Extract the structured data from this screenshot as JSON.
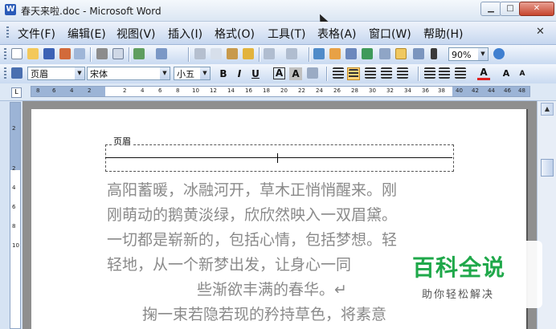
{
  "window": {
    "title": "春天来啦.doc - Microsoft Word",
    "app_icon": "W",
    "controls": {
      "minimize": "▁",
      "maximize": "□",
      "close": "✕"
    }
  },
  "menu": {
    "items": [
      "文件(F)",
      "编辑(E)",
      "视图(V)",
      "插入(I)",
      "格式(O)",
      "工具(T)",
      "表格(A)",
      "窗口(W)",
      "帮助(H)"
    ],
    "close_doc": "✕"
  },
  "standard_toolbar": {
    "zoom": "90%",
    "icons": [
      "new-doc-icon",
      "open-icon",
      "save-icon",
      "permission-icon",
      "email-icon",
      "print-icon",
      "print-preview-icon",
      "spelling-icon",
      "research-icon",
      "cut-icon",
      "copy-icon",
      "paste-icon",
      "format-painter-icon",
      "undo-icon",
      "redo-icon",
      "hyperlink-icon",
      "tables-borders-icon",
      "insert-table-icon",
      "insert-excel-icon",
      "columns-icon",
      "drawing-icon",
      "document-map-icon",
      "show-hide-icon",
      "help-icon"
    ]
  },
  "formatting_toolbar": {
    "style": "页眉",
    "font": "宋体",
    "size": "小五",
    "bold": "B",
    "italic": "I",
    "underline": "U",
    "char_border": "A",
    "char_shading": "A",
    "font_color_letter": "A",
    "grow_font": "A",
    "shrink_font": "A"
  },
  "ruler": {
    "h_ticks": [
      "8",
      "6",
      "4",
      "2",
      "2",
      "4",
      "6",
      "8",
      "10",
      "12",
      "14",
      "16",
      "18",
      "20",
      "22",
      "24",
      "26",
      "28",
      "30",
      "32",
      "34",
      "36",
      "38",
      "40",
      "42",
      "44",
      "46",
      "48"
    ],
    "v_ticks": [
      "2",
      "2",
      "4",
      "6",
      "8",
      "10"
    ]
  },
  "document": {
    "header_label": "页眉",
    "lines": [
      "高阳蓄暖，冰融河开，草木正悄悄醒来。刚",
      "刚萌动的鹅黄淡绿，欣欣然映入一双眉黛。",
      "一切都是崭新的，包括心情，包括梦想。轻",
      "轻地，从一个新梦出发，让身心一同",
      "些渐欲丰满的春华。↵",
      "掬一束若隐若现的矜持草色，将素意"
    ]
  },
  "watermark": {
    "title": "百科全说",
    "subtitle": "助你轻松解决"
  },
  "colors": {
    "accent": "#1fa84a",
    "font_color_bar": "#e02020",
    "body_text": "#8a8a8a"
  }
}
